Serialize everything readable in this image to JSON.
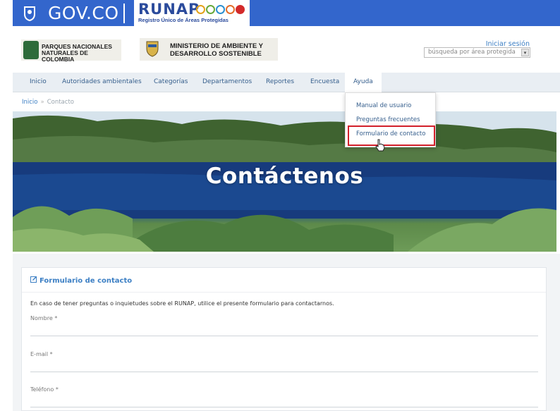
{
  "gov_bar": {
    "brand": "GOV.CO",
    "runap_title": "RUNAP",
    "runap_subtitle": "Registro Único de Áreas Protegidas"
  },
  "header": {
    "logo_pnn": "PARQUES NACIONALES NATURALES DE COLOMBIA",
    "logo_min_line1": "MINISTERIO DE AMBIENTE Y",
    "logo_min_line2": "DESARROLLO SOSTENIBLE",
    "login": "Iniciar sesión",
    "search_select": "búsqueda por área protegida"
  },
  "nav": {
    "items": [
      {
        "label": "Inicio"
      },
      {
        "label": "Autoridades ambientales"
      },
      {
        "label": "Categorías"
      },
      {
        "label": "Departamentos"
      },
      {
        "label": "Reportes"
      },
      {
        "label": "Encuesta"
      },
      {
        "label": "Ayuda"
      }
    ]
  },
  "dropdown": {
    "items": [
      {
        "label": "Manual de usuario"
      },
      {
        "label": "Preguntas frecuentes"
      },
      {
        "label": "Formulario de contacto"
      }
    ]
  },
  "breadcrumb": {
    "home": "Inicio",
    "separator": "»",
    "current": "Contacto"
  },
  "hero": {
    "title": "Contáctenos"
  },
  "form": {
    "title": "Formulario de contacto",
    "intro": "En caso de tener preguntas o inquietudes sobre el RUNAP, utilice el presente formulario para contactarnos.",
    "fields": [
      {
        "label": "Nombre *"
      },
      {
        "label": "E-mail *"
      },
      {
        "label": "Teléfono *"
      }
    ]
  },
  "colors": {
    "gov_blue": "#3366cc",
    "link_blue": "#3c7fc4",
    "highlight_red": "#d21f2a"
  }
}
